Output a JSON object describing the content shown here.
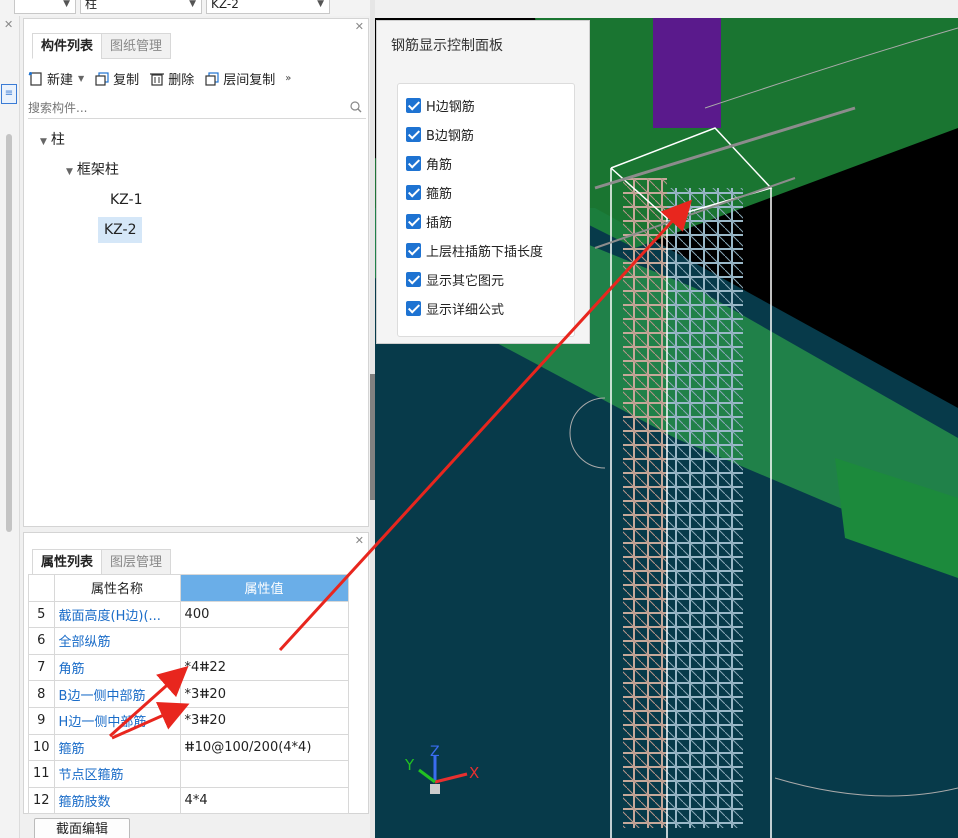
{
  "top_bar": {
    "combo1": "",
    "combo2": "柱",
    "combo3": "KZ-2"
  },
  "component_panel": {
    "tabs": [
      {
        "label": "构件列表",
        "active": true
      },
      {
        "label": "图纸管理",
        "active": false
      }
    ],
    "toolbar": {
      "new_label": "新建",
      "copy_label": "复制",
      "delete_label": "删除",
      "floor_copy_label": "层间复制",
      "more_icon": "double-chevron-right-icon"
    },
    "search_placeholder": "搜索构件...",
    "tree": {
      "root": "柱",
      "group": "框架柱",
      "items": [
        "KZ-1",
        "KZ-2"
      ],
      "selected": "KZ-2"
    }
  },
  "property_panel": {
    "tabs": [
      {
        "label": "属性列表",
        "active": true
      },
      {
        "label": "图层管理",
        "active": false
      }
    ],
    "headers": {
      "name": "属性名称",
      "value": "属性值"
    },
    "rows": [
      {
        "idx": "5",
        "name": "截面高度(H边)(...",
        "value": "400"
      },
      {
        "idx": "6",
        "name": "全部纵筋",
        "value": ""
      },
      {
        "idx": "7",
        "name": "角筋",
        "value": "*4<22"
      },
      {
        "idx": "8",
        "name": "B边一侧中部筋",
        "value": "*3<20"
      },
      {
        "idx": "9",
        "name": "H边一侧中部筋",
        "value": "*3<20"
      },
      {
        "idx": "10",
        "name": "箍筋",
        "value": "<10@100/200(4*4)"
      },
      {
        "idx": "11",
        "name": "节点区箍筋",
        "value": ""
      },
      {
        "idx": "12",
        "name": "箍筋肢数",
        "value": "4*4"
      }
    ],
    "rebar_symbol": "⏚",
    "section_edit_label": "截面编辑"
  },
  "rebar_display_panel": {
    "title": "钢筋显示控制面板",
    "options": [
      {
        "label": "H边钢筋",
        "checked": true
      },
      {
        "label": "B边钢筋",
        "checked": true
      },
      {
        "label": "角筋",
        "checked": true
      },
      {
        "label": "箍筋",
        "checked": true
      },
      {
        "label": "插筋",
        "checked": true
      },
      {
        "label": "上层柱插筋下插长度",
        "checked": true
      },
      {
        "label": "显示其它图元",
        "checked": true
      },
      {
        "label": "显示详细公式",
        "checked": true
      }
    ]
  },
  "viewport": {
    "axis_labels": {
      "x": "X",
      "y": "Y",
      "z": "Z"
    },
    "colors": {
      "background": "#000000",
      "slab": "#073a4a",
      "beam_green": "#1f8a3a",
      "column_rebar": "#c6a89a",
      "annotation_arrow": "#e8261e",
      "top_purple": "#5a1a8c"
    }
  }
}
